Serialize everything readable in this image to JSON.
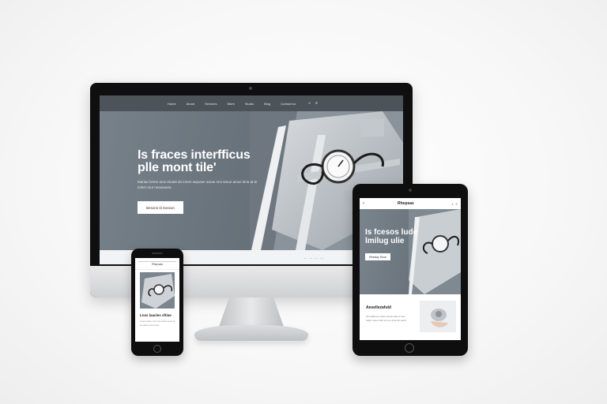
{
  "desktop": {
    "nav": {
      "links": [
        "Home",
        "About",
        "Services",
        "Work",
        "Studio",
        "Blog",
        "Contact us"
      ],
      "icons": [
        "search-icon",
        "menu-icon"
      ]
    },
    "hero": {
      "title_line1": "Is fraces interfficus",
      "title_line2": "plle mont tile'",
      "subtitle": "Mariae lorem ame irtuset do lorem seposer amae mrs tesue amos leria at te tolner mut neaosures.",
      "button": "Besons  til  Sosson"
    }
  },
  "tablet": {
    "nav": {
      "back": "‹",
      "brand": "Rhepsas"
    },
    "hero": {
      "title": "Is fcesos lude lmilug ulie",
      "button": "Reeslay Snoe"
    },
    "card": {
      "title": "Aesellezafuld",
      "text": "Oin sadiu les doue rames sule a ouei. Llaos moeu sole teu oe omao lin aetre."
    }
  },
  "phone": {
    "nav": {
      "brand": "Rhepsas"
    },
    "title": "Lnss laacles sftiae",
    "text": "Losee asteu moe oso leaie aueni ol sm aslu ue la oinsa."
  },
  "colors": {
    "hero_gray": "#6a747d",
    "nav_gray": "#4c5359",
    "device_black": "#0f0f10"
  }
}
